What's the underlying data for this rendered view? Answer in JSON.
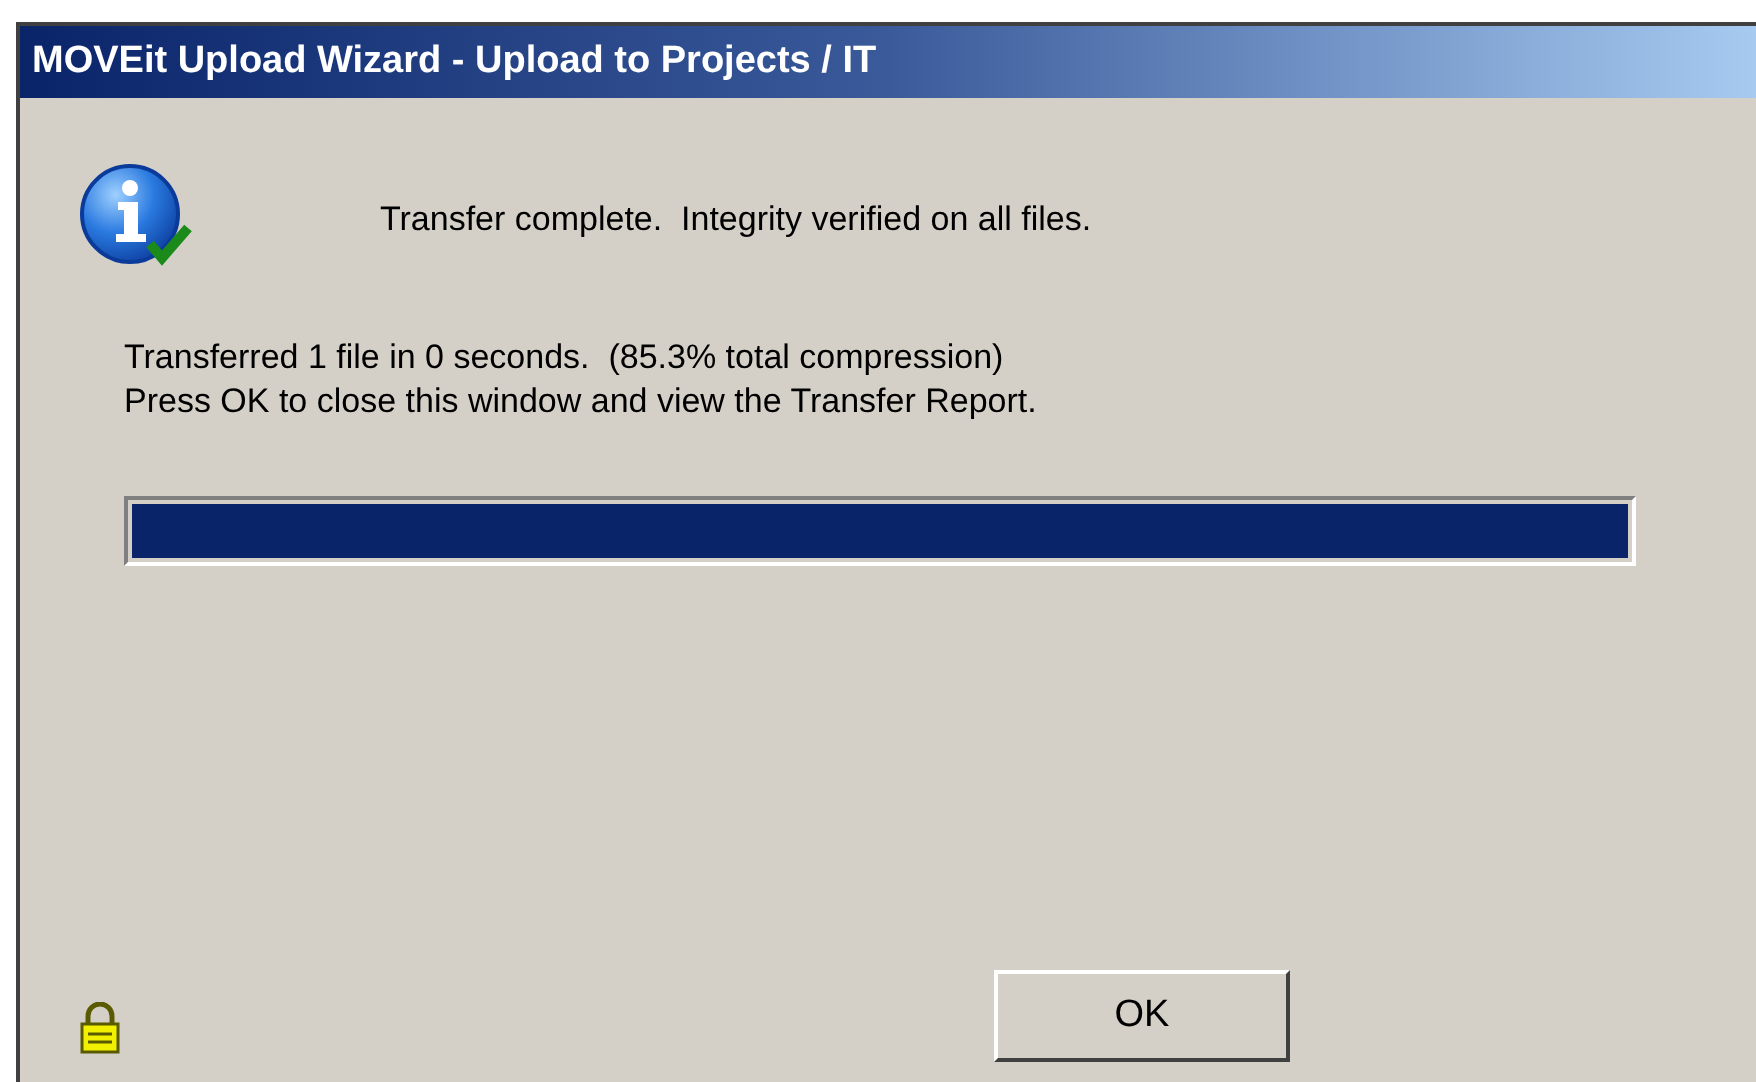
{
  "window": {
    "title": "MOVEit Upload Wizard - Upload to Projects / IT"
  },
  "message": "Transfer complete.  Integrity verified on all files.",
  "details": [
    "Transferred 1 file in 0 seconds.  (85.3% total compression)",
    "Press OK to close this window and view the Transfer Report."
  ],
  "progress": {
    "level": 1
  },
  "buttons": [
    "OK"
  ]
}
